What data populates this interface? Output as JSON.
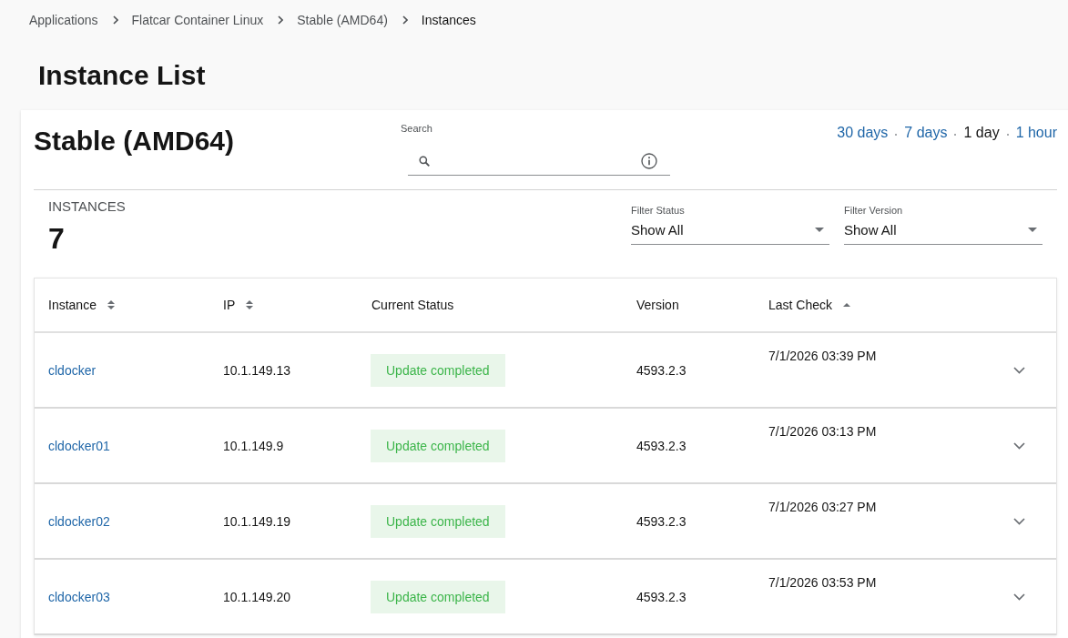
{
  "breadcrumb": [
    {
      "label": "Applications",
      "current": false
    },
    {
      "label": "Flatcar Container Linux",
      "current": false
    },
    {
      "label": "Stable (AMD64)",
      "current": false
    },
    {
      "label": "Instances",
      "current": true
    }
  ],
  "page_title": "Instance List",
  "channel_card": {
    "title": "Stable (AMD64)",
    "search": {
      "label": "Search"
    },
    "time_ranges": [
      {
        "label": "30 days",
        "selected": false
      },
      {
        "label": "7 days",
        "selected": false
      },
      {
        "label": "1 day",
        "selected": true
      },
      {
        "label": "1 hour",
        "selected": false
      }
    ]
  },
  "summary": {
    "label": "INSTANCES",
    "count": "7"
  },
  "filters": [
    {
      "label": "Filter Status",
      "value": "Show All"
    },
    {
      "label": "Filter Version",
      "value": "Show All"
    }
  ],
  "table": {
    "columns": [
      {
        "label": "Instance",
        "kind": "sortable"
      },
      {
        "label": "IP",
        "kind": "sortable"
      },
      {
        "label": "Current Status",
        "kind": "plain"
      },
      {
        "label": "Version",
        "kind": "plain"
      },
      {
        "label": "Last Check",
        "kind": "sorted"
      }
    ],
    "rows": [
      {
        "instance": "cldocker",
        "ip": "10.1.149.13",
        "status": {
          "label": "Update completed",
          "kind": "success"
        },
        "version": "4593.2.3",
        "last_check": "7/1/2026 03:39 PM",
        "expanded": false
      },
      {
        "instance": "cldocker01",
        "ip": "10.1.149.9",
        "status": {
          "label": "Update completed",
          "kind": "success"
        },
        "version": "4593.2.3",
        "last_check": "7/1/2026 03:13 PM",
        "expanded": false
      },
      {
        "instance": "cldocker02",
        "ip": "10.1.149.19",
        "status": {
          "label": "Update completed",
          "kind": "success"
        },
        "version": "4593.2.3",
        "last_check": "7/1/2026 03:27 PM",
        "expanded": false
      },
      {
        "instance": "cldocker03",
        "ip": "10.1.149.20",
        "status": {
          "label": "Update completed",
          "kind": "success"
        },
        "version": "4593.2.3",
        "last_check": "7/1/2026 03:53 PM",
        "expanded": false
      }
    ]
  }
}
